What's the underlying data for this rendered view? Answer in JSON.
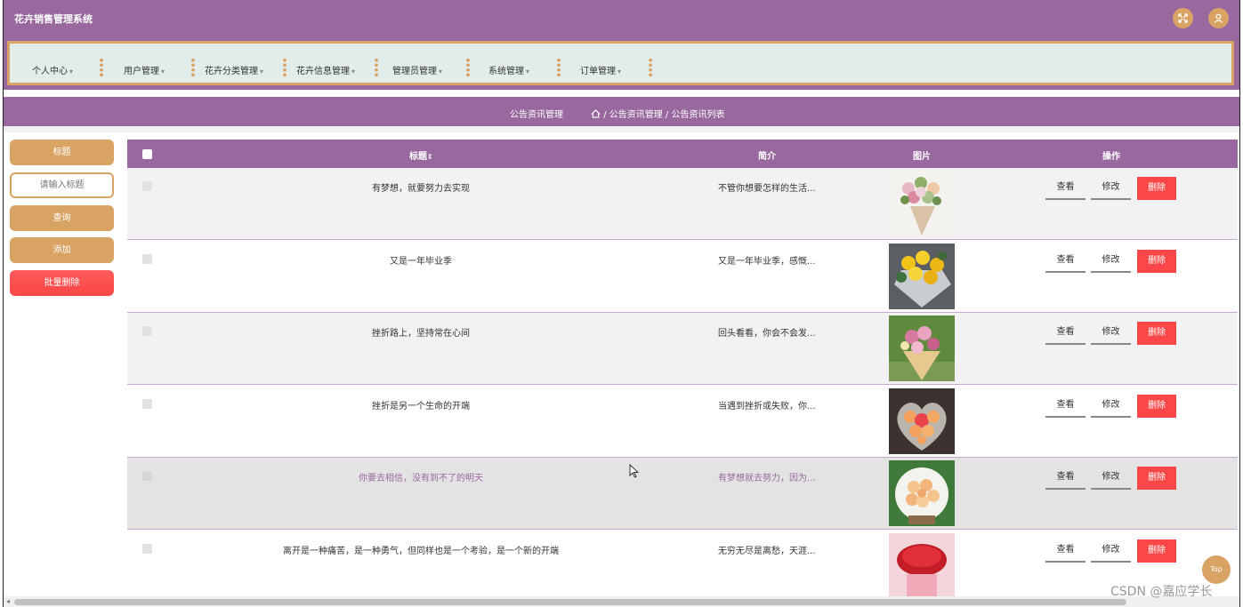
{
  "app": {
    "title": "花卉销售管理系统"
  },
  "colors": {
    "primary": "#98689e",
    "accent": "#d9a364",
    "danger": "#fb4747",
    "nav_bg": "#e2ece9"
  },
  "header": {
    "icons": [
      "fullscreen-icon",
      "user-icon"
    ]
  },
  "nav": {
    "items": [
      "个人中心",
      "用户管理",
      "花卉分类管理",
      "花卉信息管理",
      "管理员管理",
      "系统管理",
      "订单管理"
    ]
  },
  "breadcrumb": {
    "title": "公告资讯管理",
    "path": "/ 公告资讯管理 / 公告资讯列表"
  },
  "search": {
    "label": "标题",
    "placeholder": "请输入标题",
    "query_label": "查询",
    "add_label": "添加",
    "batch_delete_label": "批量删除"
  },
  "table": {
    "headers": {
      "title": "标题",
      "intro": "简介",
      "image": "图片",
      "action": "操作"
    },
    "actions": {
      "view": "查看",
      "edit": "修改",
      "delete": "删除"
    },
    "rows": [
      {
        "title": "有梦想，就要努力去实现",
        "intro": "不管你想要怎样的生活..."
      },
      {
        "title": "又是一年毕业季",
        "intro": "又是一年毕业季，感慨..."
      },
      {
        "title": "挫折路上，坚持常在心间",
        "intro": "回头看看，你会不会发..."
      },
      {
        "title": "挫折是另一个生命的开端",
        "intro": "当遇到挫折或失败，你..."
      },
      {
        "title": "你要去相信，没有到不了的明天",
        "intro": "有梦想就去努力，因为..."
      },
      {
        "title": "离开是一种痛苦，是一种勇气，但同样也是一个考验，是一个新的开端",
        "intro": "无穷无尽是离愁，天涯..."
      }
    ]
  },
  "back_to_top": "Top",
  "watermark": "CSDN @嘉应学长"
}
